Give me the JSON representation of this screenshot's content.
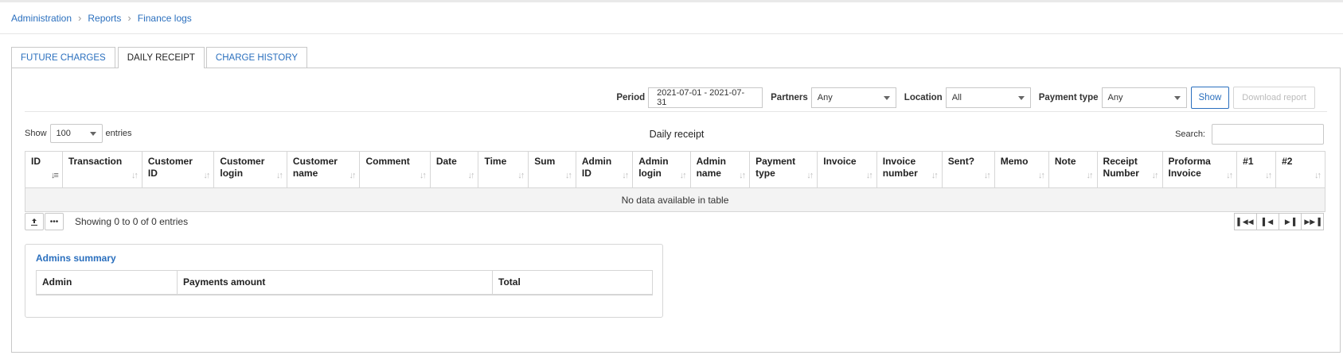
{
  "breadcrumb": [
    "Administration",
    "Reports",
    "Finance logs"
  ],
  "tabs": [
    "FUTURE CHARGES",
    "DAILY RECEIPT",
    "CHARGE HISTORY"
  ],
  "filters": {
    "period_label": "Period",
    "period_value": "2021-07-01 - 2021-07-31",
    "partners_label": "Partners",
    "partners_value": "Any",
    "location_label": "Location",
    "location_value": "All",
    "payment_type_label": "Payment type",
    "payment_type_value": "Any",
    "show_button": "Show",
    "download_button": "Download report"
  },
  "table_controls": {
    "show_label": "Show",
    "entries_value": "100",
    "entries_label": "entries",
    "title": "Daily receipt",
    "search_label": "Search:",
    "search_value": ""
  },
  "columns": [
    [
      "ID",
      ""
    ],
    [
      "Transaction",
      ""
    ],
    [
      "Customer",
      "ID"
    ],
    [
      "Customer",
      "login"
    ],
    [
      "Customer",
      "name"
    ],
    [
      "Comment",
      ""
    ],
    [
      "Date",
      ""
    ],
    [
      "Time",
      ""
    ],
    [
      "Sum",
      ""
    ],
    [
      "Admin",
      "ID"
    ],
    [
      "Admin",
      "login"
    ],
    [
      "Admin",
      "name"
    ],
    [
      "Payment",
      "type"
    ],
    [
      "Invoice",
      ""
    ],
    [
      "Invoice",
      "number"
    ],
    [
      "Sent?",
      ""
    ],
    [
      "Memo",
      ""
    ],
    [
      "Note",
      ""
    ],
    [
      "Receipt",
      "Number"
    ],
    [
      "Proforma",
      "Invoice"
    ],
    [
      "#1",
      ""
    ],
    [
      "#2",
      ""
    ]
  ],
  "empty_message": "No data available in table",
  "info_text": "Showing 0 to 0 of 0 entries",
  "summary": {
    "title": "Admins summary",
    "columns": [
      "Admin",
      "Payments amount",
      "Total"
    ]
  },
  "colors": {
    "link": "#2a6fbe",
    "border": "#c8c8c8",
    "empty_row_bg": "#f3f3f3"
  }
}
